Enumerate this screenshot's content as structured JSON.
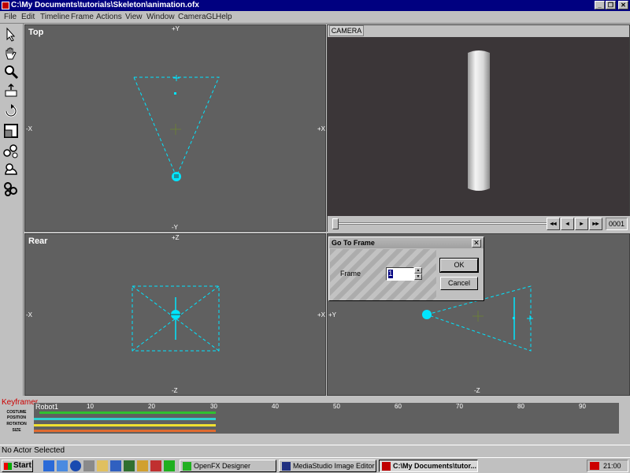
{
  "window": {
    "title": "C:\\My Documents\\tutorials\\Skeleton\\animation.ofx",
    "btn_minimize": "_",
    "btn_restore": "❐",
    "btn_close": "✕"
  },
  "menu": [
    "File",
    "Edit",
    "Timeline",
    "Frame",
    "Actions",
    "View",
    "Window",
    "CameraGL",
    "Help"
  ],
  "toolbox": [
    "select-arrow-icon",
    "pan-hand-icon",
    "zoom-magnifier-icon",
    "move-actor-icon",
    "rotate-icon",
    "scale-icon",
    "skeleton-icon",
    "path-icon",
    "chain-icon"
  ],
  "viewports": {
    "top": {
      "title": "Top",
      "pos_y": "+Y",
      "neg_y": "-Y",
      "neg_x": "-X",
      "pos_x": "+X"
    },
    "rear": {
      "title": "Rear",
      "pos_z": "+Z",
      "neg_z": "-Z",
      "neg_x": "-X",
      "pos_x": "+X"
    },
    "side": {
      "pos_y": "+Y",
      "neg_z": "-Z"
    },
    "camera": {
      "tab": "CAMERA",
      "frame_counter": "0001",
      "btn_rewind": "◂◂",
      "btn_prev": "◂",
      "btn_play": "▸",
      "btn_forward": "▸▸"
    }
  },
  "dialog": {
    "title": "Go To Frame",
    "close": "✕",
    "frame_label": "Frame",
    "frame_value": "1",
    "ok": "OK",
    "cancel": "Cancel"
  },
  "keyframer": {
    "title": "Keyframer",
    "actor": "Robot1",
    "ticks": [
      "10",
      "20",
      "30",
      "40",
      "50",
      "60",
      "70",
      "80",
      "90"
    ],
    "rows": [
      "COSTUME",
      "POSITION",
      "ROTATION",
      "SIZE"
    ]
  },
  "status": {
    "text": "No Actor Selected"
  },
  "taskbar": {
    "start": "Start",
    "tasks": [
      "OpenFX Designer",
      "MediaStudio Image Editor",
      "C:\\My Documents\\tutor..."
    ],
    "clock": "21:00"
  }
}
